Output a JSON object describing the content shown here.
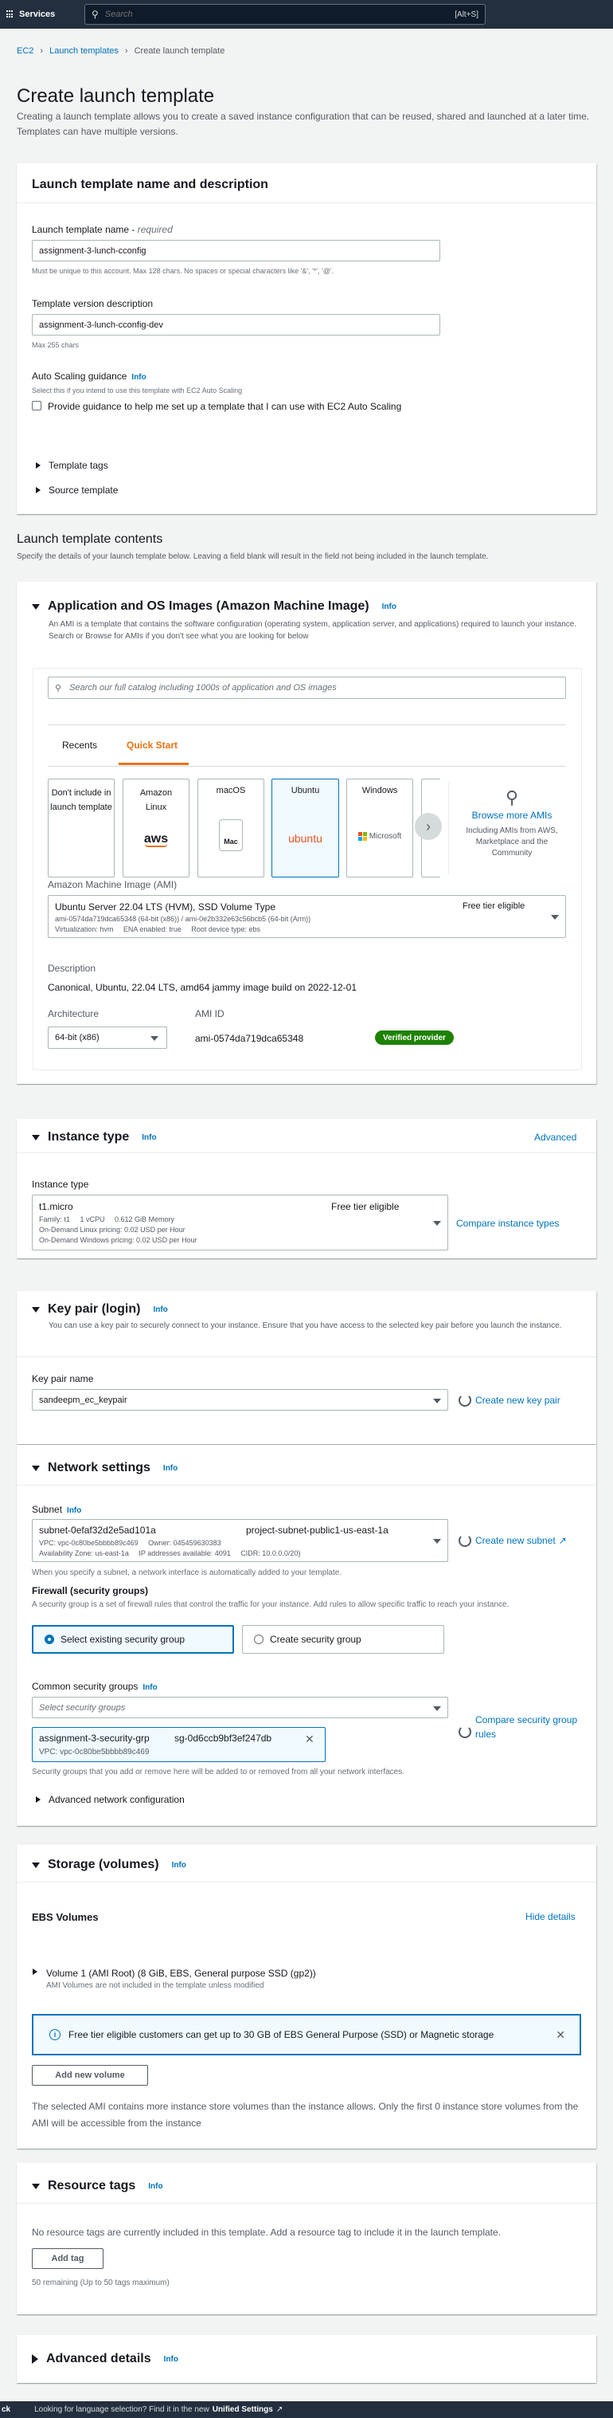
{
  "topnav": {
    "services_label": "Services",
    "search_placeholder": "Search",
    "search_shortcut": "[Alt+S]"
  },
  "breadcrumbs": [
    "EC2",
    "Launch templates",
    "Create launch template"
  ],
  "page": {
    "title": "Create launch template",
    "description": "Creating a launch template allows you to create a saved instance configuration that can be reused, shared and launched at a later time. Templates can have multiple versions."
  },
  "name_panel": {
    "title": "Launch template name and description",
    "name_label": "Launch template name - ",
    "name_required": "required",
    "name_value": "assignment-3-lunch-cconfig",
    "name_hint": "Must be unique to this account. Max 128 chars. No spaces or special characters like '&', '*', '@'.",
    "version_label": "Template version description",
    "version_value": "assignment-3-lunch-cconfig-dev",
    "version_hint": "Max 255 chars",
    "asg_label": "Auto Scaling guidance",
    "info": "Info",
    "asg_hint": "Select this if you intend to use this template with EC2 Auto Scaling",
    "asg_checkbox": "Provide guidance to help me set up a template that I can use with EC2 Auto Scaling",
    "template_tags": "Template tags",
    "source_template": "Source template"
  },
  "contents": {
    "title": "Launch template contents",
    "description": "Specify the details of your launch template below. Leaving a field blank will result in the field not being included in the launch template."
  },
  "ami": {
    "title": "Application and OS Images (Amazon Machine Image)",
    "info": "Info",
    "description": "An AMI is a template that contains the software configuration (operating system, application server, and applications) required to launch your instance. Search or Browse for AMIs if you don't see what you are looking for below",
    "search_placeholder": "Search our full catalog including 1000s of application and OS images",
    "tabs": [
      "Recents",
      "Quick Start"
    ],
    "tiles": [
      {
        "label": "Don't include in launch template",
        "logo": ""
      },
      {
        "label": "Amazon Linux",
        "logo": "aws"
      },
      {
        "label": "macOS",
        "logo": "Mac"
      },
      {
        "label": "Ubuntu",
        "logo": "ubuntu"
      },
      {
        "label": "Windows",
        "logo": "Microsoft"
      }
    ],
    "browse_title": "Browse more AMIs",
    "browse_desc": "Including AMIs from AWS, Marketplace and the Community",
    "ami_label": "Amazon Machine Image (AMI)",
    "ami_name": "Ubuntu Server 22.04 LTS (HVM), SSD Volume Type",
    "ami_free": "Free tier eligible",
    "ami_ids": "ami-0574da719dca65348 (64-bit (x86)) / ami-0e2b332e63c56bcb5 (64-bit (Arm))",
    "ami_meta": "Virtualization: hvm     ENA enabled: true     Root device type: ebs",
    "desc_label": "Description",
    "desc_value": "Canonical, Ubuntu, 22.04 LTS, amd64 jammy image build on 2022-12-01",
    "arch_label": "Architecture",
    "arch_value": "64-bit (x86)",
    "amiid_label": "AMI ID",
    "amiid_value": "ami-0574da719dca65348",
    "verified": "Verified provider"
  },
  "instance_type": {
    "title": "Instance type",
    "info": "Info",
    "advanced": "Advanced",
    "label": "Instance type",
    "value": "t1.micro",
    "free": "Free tier eligible",
    "family": "Family: t1     1 vCPU     0.612 GiB Memory",
    "linux_price": "On-Demand Linux pricing: 0.02 USD per Hour",
    "windows_price": "On-Demand Windows pricing: 0.02 USD per Hour",
    "compare": "Compare instance types"
  },
  "key_pair": {
    "title": "Key pair (login)",
    "info": "Info",
    "description": "You can use a key pair to securely connect to your instance. Ensure that you have access to the selected key pair before you launch the instance.",
    "label": "Key pair name",
    "value": "sandeepm_ec_keypair",
    "create": "Create new key pair"
  },
  "network": {
    "title": "Network settings",
    "info": "Info",
    "subnet_label": "Subnet",
    "subnet_id": "subnet-0efaf32d2e5ad101a",
    "subnet_name": "project-subnet-public1-us-east-1a",
    "subnet_vpc": "VPC: vpc-0c80be5bbbb89c469     Owner: 045459630383",
    "subnet_az": "Availability Zone: us-east-1a     IP addresses available: 4091     CIDR: 10.0.0.0/20)",
    "create_subnet": "Create new subnet",
    "subnet_hint": "When you specify a subnet, a network interface is automatically added to your template.",
    "firewall_label": "Firewall (security groups)",
    "firewall_hint": "A security group is a set of firewall rules that control the traffic for your instance. Add rules to allow specific traffic to reach your instance.",
    "opt_existing": "Select existing security group",
    "opt_create": "Create security group",
    "csg_label": "Common security groups",
    "csg_placeholder": "Select security groups",
    "compare_sg": "Compare security group rules",
    "sg_name": "assignment-3-security-grp",
    "sg_id": "sg-0d6ccb9bf3ef247db",
    "sg_vpc": "VPC: vpc-0c80be5bbbb89c469",
    "sg_hint": "Security groups that you add or remove here will be added to or removed from all your network interfaces.",
    "advanced": "Advanced network configuration"
  },
  "storage": {
    "title": "Storage (volumes)",
    "info": "Info",
    "ebs": "EBS Volumes",
    "hide": "Hide details",
    "volume": "Volume 1 (AMI Root) (8 GiB, EBS, General purpose SSD (gp2))",
    "volume_note": "AMI Volumes are not included in the template unless modified",
    "alert": "Free tier eligible customers can get up to 30 GB of EBS General Purpose (SSD) or Magnetic storage",
    "add_volume": "Add new volume",
    "note": "The selected AMI contains more instance store volumes than the instance allows. Only the first 0 instance store volumes from the AMI will be accessible from the instance"
  },
  "tags": {
    "title": "Resource tags",
    "info": "Info",
    "desc": "No resource tags are currently included in this template. Add a resource tag to include it in the launch template.",
    "add": "Add tag",
    "remaining": "50 remaining (Up to 50 tags maximum)"
  },
  "advanced": {
    "title": "Advanced details",
    "info": "Info"
  },
  "footer": {
    "prefix": "ck",
    "text": "Looking for language selection? Find it in the new",
    "link": "Unified Settings"
  }
}
